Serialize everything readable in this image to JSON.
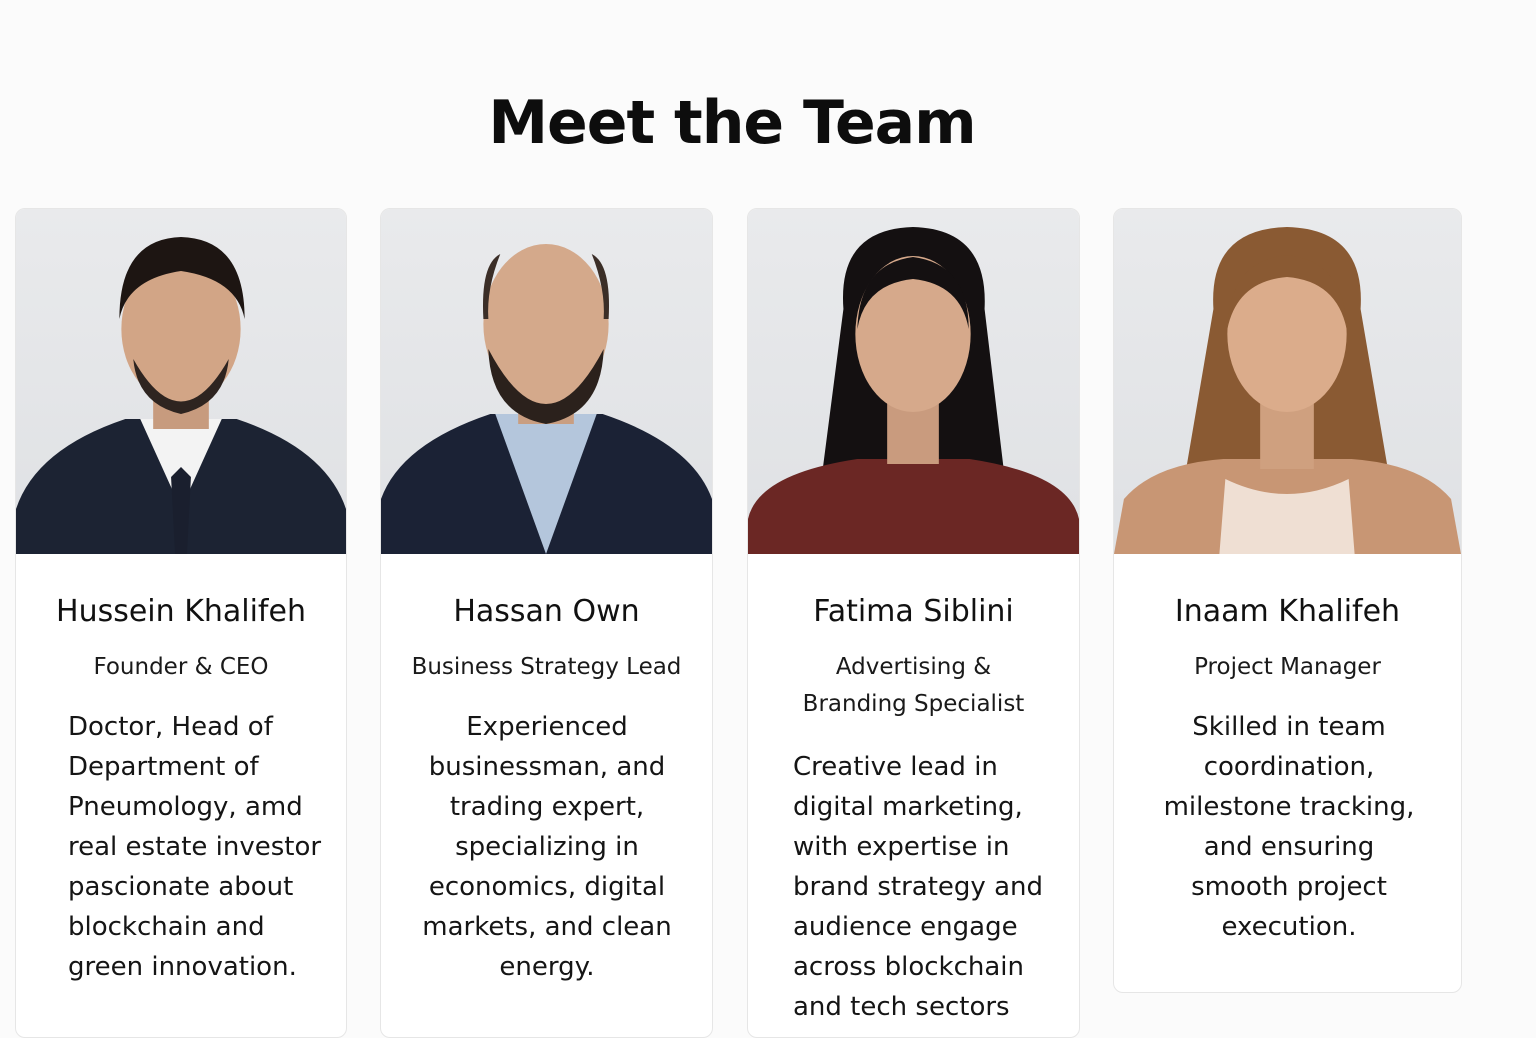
{
  "page": {
    "title": "Meet the Team"
  },
  "team": [
    {
      "name": "Hussein Khalifeh",
      "role": "Founder & CEO",
      "bio": "Doctor, Head of Department of Pneumology, amd real estate investor pascionate about blockchain and green innovation."
    },
    {
      "name": "Hassan Own",
      "role": "Business Strategy Lead",
      "bio": "Experienced businessman, and trading expert, specializing in economics, digital markets, and clean energy."
    },
    {
      "name": "Fatima Siblini",
      "role": "Advertising & Branding Specialist",
      "bio": "Creative lead in digital marketing, with expertise in brand strategy and audience engage across blockchain and tech sectors"
    },
    {
      "name": "Inaam Khalifeh",
      "role": "Project Manager",
      "bio": "Skilled in team coordination, milestone tracking, and ensuring smooth project execution."
    }
  ],
  "colors": {
    "background": "#fbfbfb",
    "card": "#ffffff",
    "photo_backdrop": "#e4e5e7"
  }
}
